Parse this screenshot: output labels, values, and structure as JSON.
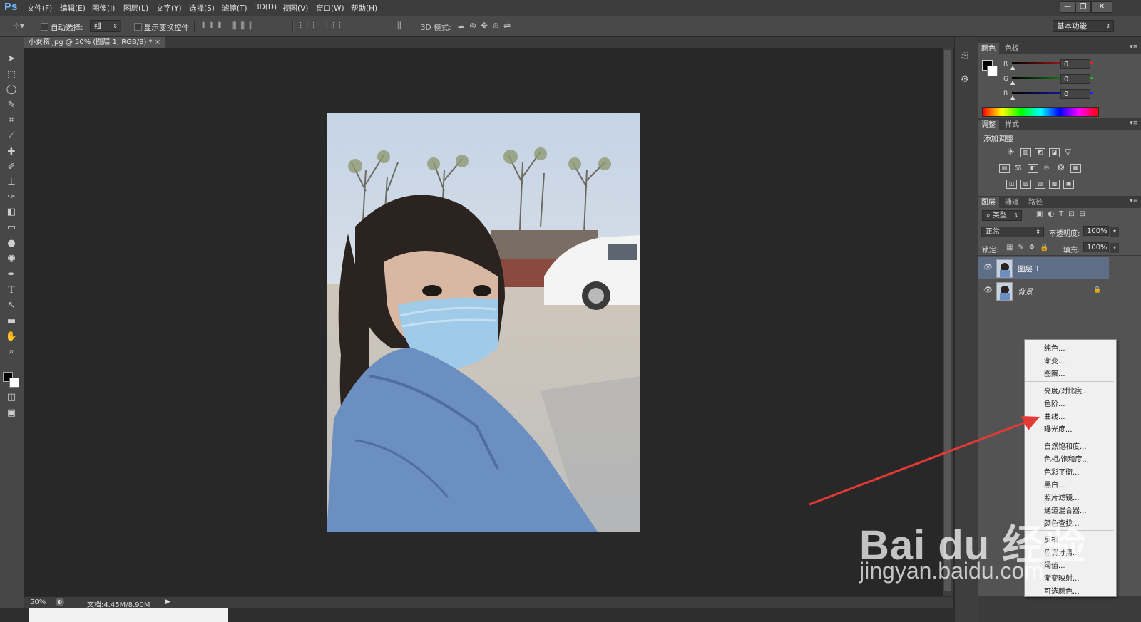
{
  "app": {
    "logo": "Ps"
  },
  "menu": {
    "items": [
      "文件(F)",
      "编辑(E)",
      "图像(I)",
      "图层(L)",
      "文字(Y)",
      "选择(S)",
      "滤镜(T)",
      "3D(D)",
      "视图(V)",
      "窗口(W)",
      "帮助(H)"
    ]
  },
  "window_controls": {
    "minimize": "—",
    "restore": "❐",
    "close": "✕"
  },
  "options": {
    "auto_select_label": "自动选择:",
    "auto_select_value": "组",
    "show_transform_label": "显示变换控件",
    "mode_3d_label": "3D 模式:",
    "workspace": "基本功能"
  },
  "document": {
    "tab_title": "小女孩.jpg @ 50% (图层 1, RGB/8) *",
    "tab_close": "×"
  },
  "status": {
    "zoom": "50%",
    "doc_info": "文档:4.45M/8.90M"
  },
  "color_panel": {
    "tabs": [
      "颜色",
      "色板"
    ],
    "channels": [
      {
        "label": "R",
        "value": "0",
        "color": "#ff2020"
      },
      {
        "label": "G",
        "value": "0",
        "color": "#20c020"
      },
      {
        "label": "B",
        "value": "0",
        "color": "#2020ff"
      }
    ]
  },
  "adjust_panel": {
    "tabs": [
      "调整",
      "样式"
    ],
    "title": "添加调整"
  },
  "layers_panel": {
    "tabs": [
      "图层",
      "通道",
      "路径"
    ],
    "filter_kind": "类型",
    "blend_mode": "正常",
    "opacity_label": "不透明度:",
    "opacity_value": "100%",
    "lock_label": "锁定:",
    "fill_label": "填充:",
    "fill_value": "100%",
    "layers": [
      {
        "name": "图层 1",
        "selected": true,
        "locked": false
      },
      {
        "name": "背景",
        "selected": false,
        "locked": true
      }
    ]
  },
  "context_menu": {
    "groups": [
      [
        "纯色...",
        "渐变...",
        "图案..."
      ],
      [
        "亮度/对比度...",
        "色阶...",
        "曲线...",
        "曝光度..."
      ],
      [
        "自然饱和度...",
        "色相/饱和度...",
        "色彩平衡...",
        "黑白...",
        "照片滤镜...",
        "通道混合器...",
        "颜色查找..."
      ],
      [
        "反相",
        "色调分离...",
        "阈值...",
        "渐变映射...",
        "可选颜色..."
      ]
    ]
  },
  "watermark": {
    "brand": "Bai du 经验",
    "url": "jingyan.baidu.com"
  },
  "colors": {
    "accent_arrow": "#e53935",
    "selected_layer": "#5d6e86"
  }
}
